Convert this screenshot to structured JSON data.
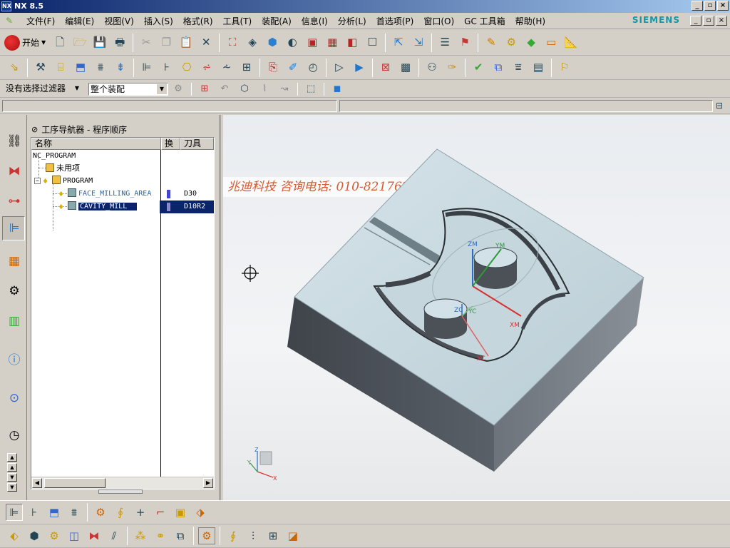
{
  "window": {
    "title": "NX 8.5",
    "logo": "NX"
  },
  "menubar": {
    "items": [
      "文件(F)",
      "编辑(E)",
      "视图(V)",
      "插入(S)",
      "格式(R)",
      "工具(T)",
      "装配(A)",
      "信息(I)",
      "分析(L)",
      "首选项(P)",
      "窗口(O)",
      "GC 工具箱",
      "帮助(H)"
    ],
    "brand": "SIEMENS"
  },
  "toolbar": {
    "start_label": "开始",
    "selection_filter": "没有选择过滤器",
    "assembly_scope": "整个装配"
  },
  "navigator": {
    "title": "工序导航器 - 程序顺序",
    "columns": {
      "name": "名称",
      "change": "换",
      "tool": "刀具"
    },
    "rows": [
      {
        "name": "NC_PROGRAM",
        "tool": ""
      },
      {
        "name": "未用项",
        "tool": ""
      },
      {
        "name": "PROGRAM",
        "tool": ""
      },
      {
        "name": "FACE_MILLING_AREA",
        "tool": "D30"
      },
      {
        "name": "CAVITY_MILL",
        "tool": "D10R2"
      }
    ]
  },
  "viewport": {
    "watermark": "兆迪科技 咨询电话: 010-82176248",
    "wcs_labels": {
      "zm": "ZM",
      "ym": "YM",
      "xm": "XM",
      "zc": "ZC",
      "yc": "YC",
      "xc": "XC"
    },
    "triad_labels": {
      "z": "Z",
      "y": "Y",
      "x": "X"
    }
  },
  "colors": {
    "titlebar": "#0a246a",
    "selection": "#0a246a",
    "watermark": "#d85a30",
    "model_top": "#c9d9df",
    "model_side": "#4a4f56"
  }
}
